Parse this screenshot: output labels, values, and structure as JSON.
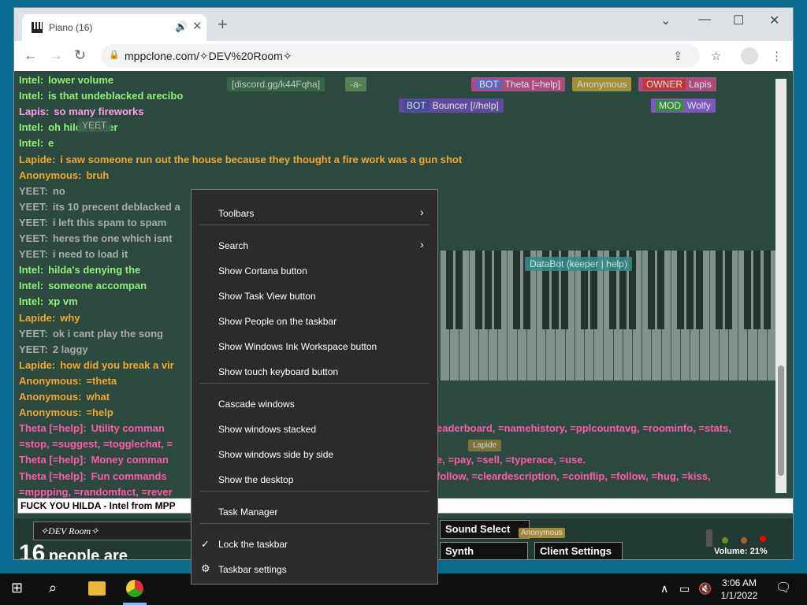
{
  "browser": {
    "tab_title": "Piano (16)",
    "url": "mppclone.com/✧DEV%20Room✧"
  },
  "chat": [
    {
      "name": "Intel:",
      "msg": "lower volume",
      "color": "#8ef07a"
    },
    {
      "name": "Intel:",
      "msg": "is that undeblacked arecibo",
      "color": "#8ef07a"
    },
    {
      "name": "Lapis:",
      "msg": "so many fireworks",
      "color": "#ff9ee8"
    },
    {
      "name": "Intel:",
      "msg": "oh hilda's ther",
      "color": "#8ef07a"
    },
    {
      "name": "Intel:",
      "msg": "e",
      "color": "#8ef07a"
    },
    {
      "name": "Lapide:",
      "msg": "i saw someone run out the house because they thought a fire work was a gun shot",
      "color": "#f0a830"
    },
    {
      "name": "Anonymous:",
      "msg": "bruh",
      "color": "#f0a830"
    },
    {
      "name": "YEET:",
      "msg": "no",
      "color": "#aaaaaa"
    },
    {
      "name": "YEET:",
      "msg": "its 10 precent deblacked a",
      "color": "#aaaaaa"
    },
    {
      "name": "YEET:",
      "msg": "i left this spam to spam",
      "color": "#aaaaaa"
    },
    {
      "name": "YEET:",
      "msg": "heres the one which isnt",
      "color": "#aaaaaa"
    },
    {
      "name": "YEET:",
      "msg": "i need to load it",
      "color": "#aaaaaa"
    },
    {
      "name": "Intel:",
      "msg": "hilda's denying the",
      "color": "#8ef07a"
    },
    {
      "name": "Intel:",
      "msg": "someone accompan",
      "color": "#8ef07a"
    },
    {
      "name": "Intel:",
      "msg": "xp vm",
      "color": "#8ef07a"
    },
    {
      "name": "Lapide:",
      "msg": "why",
      "color": "#f0a830"
    },
    {
      "name": "YEET:",
      "msg": "ok i cant play the song",
      "color": "#aaaaaa"
    },
    {
      "name": "YEET:",
      "msg": "2 laggy",
      "color": "#aaaaaa"
    },
    {
      "name": "Lapide:",
      "msg": "how did you break a vir",
      "color": "#f0a830"
    },
    {
      "name": "Anonymous:",
      "msg": "=theta",
      "color": "#f0a830"
    },
    {
      "name": "Anonymous:",
      "msg": "what",
      "color": "#f0a830"
    },
    {
      "name": "Anonymous:",
      "msg": "=help",
      "color": "#f0a830"
    },
    {
      "name": "Theta [=help]:",
      "msg": "Utility comman",
      "color": "#ff5aa8"
    },
    {
      "name": "",
      "msg": "=stop, =suggest, =togglechat, =",
      "color": "#ff5aa8"
    },
    {
      "name": "Theta [=help]:",
      "msg": "Money comman",
      "color": "#ff5aa8"
    },
    {
      "name": "Theta [=help]:",
      "msg": "Fun commands",
      "color": "#ff5aa8"
    },
    {
      "name": "",
      "msg": "=mppping, =randomfact, =rever",
      "color": "#ff5aa8"
    }
  ],
  "chat_right_fragments": [
    "eaderboard, =namehistory, =pplcountavg, =roominfo, =stats,",
    "e, =pay, =sell, =typerace, =use.",
    "follow, =cleardescription, =coinflip, =follow, =hug, =kiss,"
  ],
  "user_tags": [
    "[discord.gg/k44Fqha]",
    "-a-",
    "Theta [=help]",
    "Anonymous",
    "Lapis",
    "Bouncer [//help]",
    "Wolfy",
    "YEET",
    "DataBot (keeper | help)",
    "Lapide",
    "Anonymous"
  ],
  "badges": {
    "bot": "BOT",
    "owner": "OWNER",
    "mod": "MOD"
  },
  "chat_input_value": "FUCK YOU HILDA - Intel from MPP",
  "room": {
    "name": "✧DEV Room✧",
    "count": "16",
    "people_text": "people are"
  },
  "buttons": {
    "sound_select": "Sound Select",
    "synth": "Synth",
    "client_settings": "Client Settings"
  },
  "volume": "Volume: 21%",
  "context_menu": {
    "items": [
      {
        "label": "Toolbars",
        "submenu": true
      },
      {
        "label": "Search",
        "submenu": true
      },
      {
        "label": "Show Cortana button"
      },
      {
        "label": "Show Task View button"
      },
      {
        "label": "Show People on the taskbar"
      },
      {
        "label": "Show Windows Ink Workspace button"
      },
      {
        "label": "Show touch keyboard button"
      },
      {
        "label": "Cascade windows"
      },
      {
        "label": "Show windows stacked"
      },
      {
        "label": "Show windows side by side"
      },
      {
        "label": "Show the desktop"
      },
      {
        "label": "Task Manager"
      },
      {
        "label": "Lock the taskbar",
        "checked": true
      },
      {
        "label": "Taskbar settings"
      }
    ]
  },
  "taskbar": {
    "time": "3:06 AM",
    "date": "1/1/2022"
  },
  "colors": {
    "menu_bg": "#2b2b2b",
    "page_bg": "#2c4a3f",
    "taskbar_bg": "#101010"
  }
}
